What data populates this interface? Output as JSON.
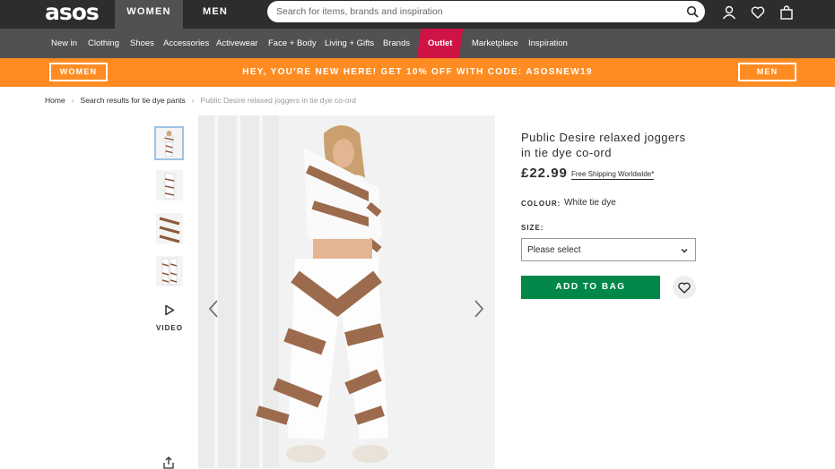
{
  "header": {
    "logo": "asos",
    "tabs": [
      "WOMEN",
      "MEN"
    ],
    "search_placeholder": "Search for items, brands and inspiration",
    "icons": [
      "search-icon",
      "account-icon",
      "heart-icon",
      "bag-icon"
    ]
  },
  "nav": {
    "items": [
      "New in",
      "Clothing",
      "Shoes",
      "Accessories",
      "Activewear",
      "Face + Body",
      "Living + Gifts",
      "Brands",
      "Outlet",
      "Marketplace",
      "Inspiration"
    ]
  },
  "promo": {
    "women_label": "WOMEN",
    "text": "HEY, YOU'RE NEW HERE! GET 10% OFF WITH CODE: ASOSNEW19",
    "men_label": "MEN"
  },
  "breadcrumb": {
    "home": "Home",
    "search": "Search results for tie dye pants",
    "current": "Public Desire relaxed joggers in tie dye co-ord"
  },
  "gallery": {
    "video_label": "VIDEO"
  },
  "product": {
    "title": "Public Desire relaxed joggers in tie dye co-ord",
    "price": "£22.99",
    "shipping": "Free Shipping Worldwide*",
    "colour_label": "COLOUR:",
    "colour_value": "White tie dye",
    "size_label": "SIZE:",
    "size_placeholder": "Please select",
    "add_to_bag": "ADD TO BAG"
  },
  "colors": {
    "header": "#2d2d2d",
    "nav": "#525050",
    "outlet": "#d01345",
    "promo": "#ff8c22",
    "add_to_bag": "#018849"
  }
}
